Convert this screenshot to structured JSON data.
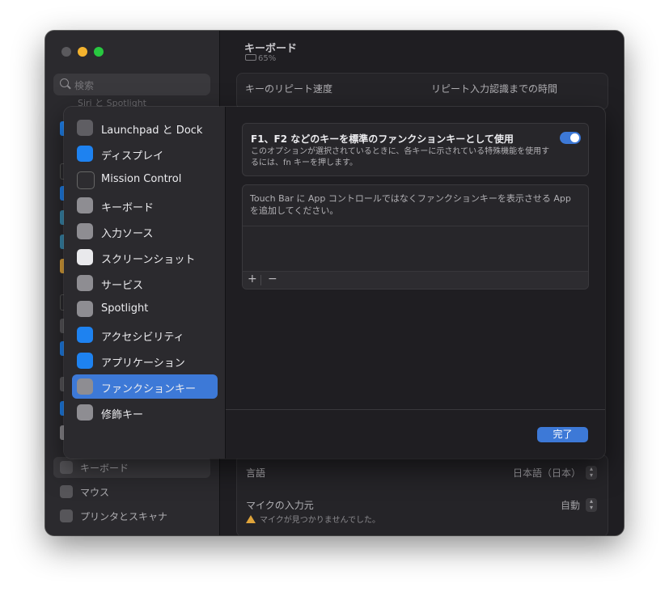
{
  "window": {
    "traffic_lights": [
      "#5a595d",
      "#f4b32e",
      "#28c840"
    ],
    "sidebar": {
      "search_placeholder": "検索",
      "cut_item": "Siri と Spotlight",
      "bottom_items": [
        {
          "label": "キーボード",
          "selected": true
        },
        {
          "label": "マウス",
          "selected": false
        },
        {
          "label": "プリンタとスキャナ",
          "selected": false
        }
      ]
    },
    "main": {
      "title": "キーボード",
      "battery": "65%",
      "key_repeat_label": "キーのリピート速度",
      "repeat_delay_label": "リピート入力認識までの時間",
      "language_label": "言語",
      "language_value": "日本語（日本）",
      "mic_label": "マイクの入力元",
      "mic_value": "自動",
      "mic_warning": "マイクが見つかりませんでした。"
    }
  },
  "modal": {
    "sidebar_items": [
      {
        "label": "Launchpad と Dock",
        "icon": "launchpad-icon",
        "color": "#5f5e63"
      },
      {
        "label": "ディスプレイ",
        "icon": "display-icon",
        "color": "#1e82f0"
      },
      {
        "label": "Mission Control",
        "icon": "mission-control-icon",
        "color": "#2d2c30"
      },
      {
        "label": "キーボード",
        "icon": "keyboard-icon",
        "color": "#8e8d92"
      },
      {
        "label": "入力ソース",
        "icon": "input-source-icon",
        "color": "#8e8d92"
      },
      {
        "label": "スクリーンショット",
        "icon": "screenshot-icon",
        "color": "#e9e9ec"
      },
      {
        "label": "サービス",
        "icon": "services-icon",
        "color": "#8e8d92"
      },
      {
        "label": "Spotlight",
        "icon": "spotlight-icon",
        "color": "#8e8d92"
      },
      {
        "label": "アクセシビリティ",
        "icon": "accessibility-icon",
        "color": "#1e82f0"
      },
      {
        "label": "アプリケーション",
        "icon": "app-store-icon",
        "color": "#1e82f0"
      },
      {
        "label": "ファンクションキー",
        "icon": "fn-icon",
        "color": "#8e8d92",
        "selected": true
      },
      {
        "label": "修飾キー",
        "icon": "modifier-keys-icon",
        "color": "#8e8d92"
      }
    ],
    "fn_card": {
      "title": "F1、F2 などのキーを標準のファンクションキーとして使用",
      "description": "このオプションが選択されているときに、各キーに示されている特殊機能を使用するには、fn キーを押します。",
      "toggle_on": true
    },
    "touchbar_card": {
      "description": "Touch Bar に App コントロールではなくファンクションキーを表示させる App を追加してください。",
      "add_label": "+",
      "remove_label": "−"
    },
    "done_label": "完了"
  }
}
